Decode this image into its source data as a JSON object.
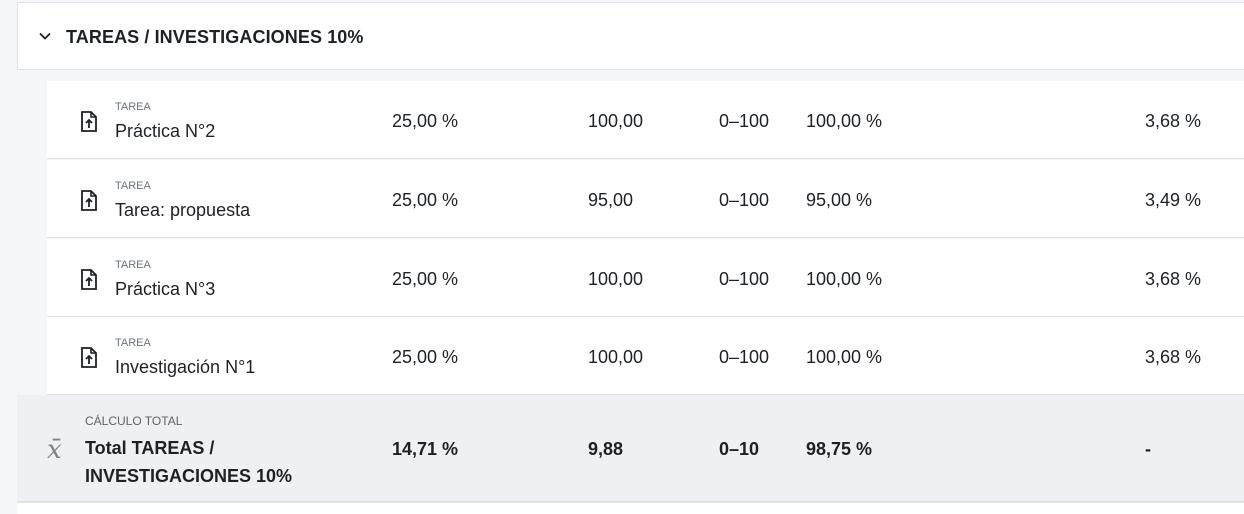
{
  "category": {
    "title": "TAREAS / INVESTIGACIONES 10%",
    "icon": "chevron-down-icon"
  },
  "items": [
    {
      "type": "TAREA",
      "name": "Práctica N°2",
      "weight": "25,00 %",
      "grade": "100,00",
      "range": "0–100",
      "percentage": "100,00 %",
      "contribution": "3,68 %",
      "icon": "assignment-upload-icon"
    },
    {
      "type": "TAREA",
      "name": "Tarea: propuesta",
      "weight": "25,00 %",
      "grade": "95,00",
      "range": "0–100",
      "percentage": "95,00 %",
      "contribution": "3,49 %",
      "icon": "assignment-upload-icon"
    },
    {
      "type": "TAREA",
      "name": "Práctica N°3",
      "weight": "25,00 %",
      "grade": "100,00",
      "range": "0–100",
      "percentage": "100,00 %",
      "contribution": "3,68 %",
      "icon": "assignment-upload-icon"
    },
    {
      "type": "TAREA",
      "name": "Investigación N°1",
      "weight": "25,00 %",
      "grade": "100,00",
      "range": "0–100",
      "percentage": "100,00 %",
      "contribution": "3,68 %",
      "icon": "assignment-upload-icon"
    }
  ],
  "total": {
    "type": "CÁLCULO TOTAL",
    "name": "Total TAREAS / INVESTIGACIONES 10%",
    "weight": "14,71 %",
    "grade": "9,88",
    "range": "0–10",
    "percentage": "98,75 %",
    "contribution": "-",
    "icon_glyph": "x̄",
    "icon": "mean-calculation-icon"
  }
}
